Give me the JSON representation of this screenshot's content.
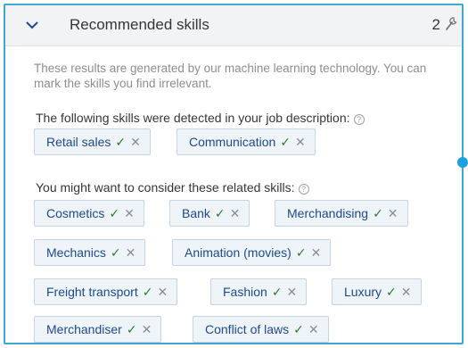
{
  "panel": {
    "title": "Recommended skills",
    "count": "2"
  },
  "hint": "These results are generated by our machine learning technology. You can mark the skills you find irrelevant.",
  "detected": {
    "label": "The following skills were detected in your job description:",
    "skills": [
      "Retail sales",
      "Communication"
    ]
  },
  "related": {
    "label": "You might want to consider these related skills:",
    "skills": [
      "Cosmetics",
      "Bank",
      "Merchandising",
      "Mechanics",
      "Animation (movies)",
      "Freight transport",
      "Fashion",
      "Luxury",
      "Merchandiser",
      "Conflict of laws"
    ]
  },
  "glyphs": {
    "check": "✓",
    "remove": "✕",
    "help": "?"
  },
  "colors": {
    "accent": "#3fa7d6",
    "chip_text": "#1c4a8d",
    "check": "#2b7d2b"
  }
}
